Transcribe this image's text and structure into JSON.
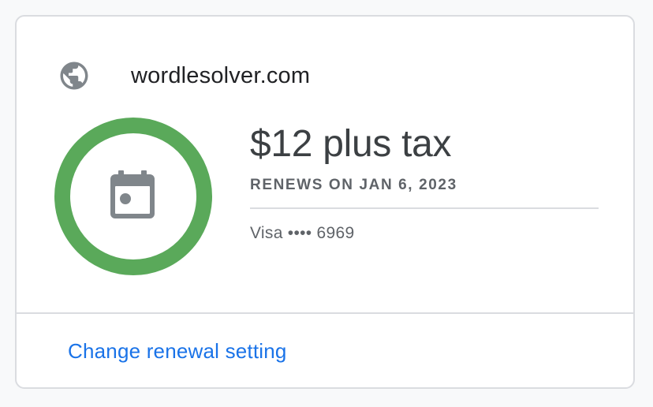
{
  "site": {
    "domain": "wordlesolver.com",
    "icon": "globe-icon"
  },
  "subscription": {
    "price": "$12 plus tax",
    "renews": "RENEWS ON JAN 6, 2023",
    "payment_method": "Visa •••• 6969",
    "status_icon": "calendar-icon",
    "ring_color": "#5aa95a"
  },
  "actions": {
    "change_renewal_label": "Change renewal setting"
  },
  "colors": {
    "link": "#1a73e8",
    "icon_gray": "#80868b",
    "text_primary": "#202124",
    "text_secondary": "#5f6368"
  }
}
